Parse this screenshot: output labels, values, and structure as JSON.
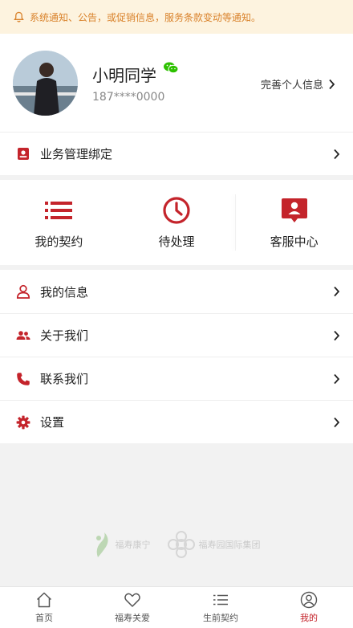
{
  "notice": {
    "text": "系统通知、公告，或促销信息，服务条款变动等通知。",
    "icon": "bell-icon"
  },
  "profile": {
    "name": "小明同学",
    "phone": "187****0000",
    "complete_label": "完善个人信息",
    "badge_icon": "wechat-icon"
  },
  "business": {
    "label": "业务管理绑定",
    "icon": "id-card-icon"
  },
  "quick": [
    {
      "label": "我的契约",
      "icon": "list-icon"
    },
    {
      "label": "待处理",
      "icon": "clock-icon"
    },
    {
      "label": "客服中心",
      "icon": "chat-person-icon"
    }
  ],
  "menu": [
    {
      "label": "我的信息",
      "icon": "user-icon"
    },
    {
      "label": "关于我们",
      "icon": "group-icon"
    },
    {
      "label": "联系我们",
      "icon": "phone-icon"
    },
    {
      "label": "设置",
      "icon": "gear-icon"
    }
  ],
  "footer_logos": [
    {
      "text": "福寿康宁"
    },
    {
      "text": "福寿园国际集团"
    }
  ],
  "tabs": [
    {
      "label": "首页",
      "icon": "home-icon",
      "active": false
    },
    {
      "label": "福寿关爱",
      "icon": "heart-icon",
      "active": false
    },
    {
      "label": "生前契约",
      "icon": "list-icon",
      "active": false
    },
    {
      "label": "我的",
      "icon": "profile-icon",
      "active": true
    }
  ],
  "colors": {
    "accent": "#c4242b",
    "notice_bg": "#fdf3df",
    "notice_text": "#d9822b",
    "wechat": "#2dc100"
  }
}
